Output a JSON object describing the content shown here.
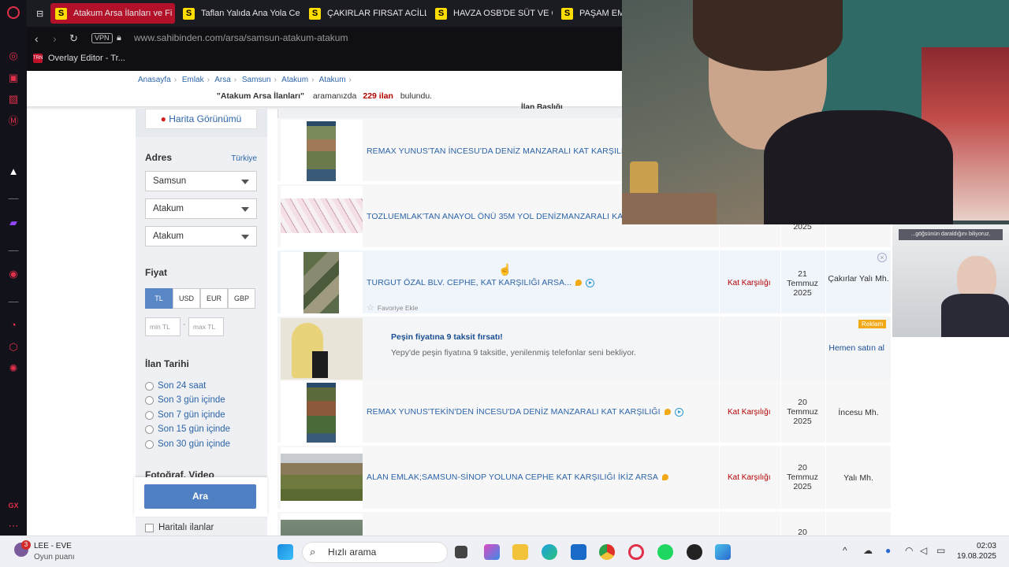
{
  "browser": {
    "tabs": [
      {
        "label": "Atakum Arsa İlanları ve Fi",
        "favicon": "S",
        "active": true
      },
      {
        "label": "Taflan Yalıda Ana Yola Ce",
        "favicon": "S",
        "active": false
      },
      {
        "label": "ÇAKIRLAR FIRSAT ACİLL",
        "favicon": "S",
        "active": false
      },
      {
        "label": "HAVZA OSB'DE SÜT VE G",
        "favicon": "S",
        "active": false
      },
      {
        "label": "PAŞAM EMI",
        "favicon": "S",
        "active": false
      }
    ],
    "vpn_label": "VPN",
    "url": "www.sahibinden.com/arsa/samsun-atakum-atakum",
    "bookmark": {
      "label": "Overlay Editor - Tr...",
      "icon_text": "TRN"
    }
  },
  "page": {
    "breadcrumb": [
      "Anasayfa",
      "Emlak",
      "Arsa",
      "Samsun",
      "Atakum",
      "Atakum"
    ],
    "result": {
      "query": "\"Atakum Arsa İlanları\"",
      "middle": "aramanızda",
      "count": "229 ilan",
      "suffix": "bulundu."
    },
    "table_header": "İlan Başlığı"
  },
  "filter": {
    "map_button": "Harita Görünümü",
    "address_title": "Adres",
    "address_country_link": "Türkiye",
    "address_selects": [
      "Samsun",
      "Atakum",
      "Atakum"
    ],
    "price_title": "Fiyat",
    "currencies": [
      "TL",
      "USD",
      "EUR",
      "GBP"
    ],
    "min_placeholder": "min TL",
    "max_placeholder": "max TL",
    "range_dash": "-",
    "date_title": "İlan Tarihi",
    "date_options": [
      "Son 24 saat",
      "Son 3 gün içinde",
      "Son 7 gün içinde",
      "Son 15 gün içinde",
      "Son 30 gün içinde"
    ],
    "media_title": "Fotoğraf, Video",
    "search_button": "Ara",
    "map_checkbox_label": "Haritalı ilanlar"
  },
  "listings": [
    {
      "title": "REMAX YUNUS'TAN İNCESU'DA DENİZ MANZARALI KAT KARŞILIĞI AR",
      "price": "",
      "date": [
        "",
        "",
        ""
      ],
      "location": ""
    },
    {
      "title": "TOZLUEMLAK'TAN ANAYOL ÖNÜ 35M YOL DENİZMANZARALI KAT KA",
      "price": "",
      "date": [
        "",
        "",
        "2025"
      ],
      "location": ""
    },
    {
      "title": "TURGUT ÖZAL BLV. CEPHE, KAT KARŞILIĞI ARSA...",
      "price": "Kat Karşılığı",
      "date": [
        "21",
        "Temmuz",
        "2025"
      ],
      "location": "Çakırlar Yalı Mh.",
      "favorite": "Favoriye Ekle"
    },
    {
      "title": "REMAX YUNUS'TEKİN'DEN İNCESU'DA DENİZ MANZARALI KAT KARŞILIĞI",
      "price": "Kat Karşılığı",
      "date": [
        "20",
        "Temmuz",
        "2025"
      ],
      "location": "İncesu Mh."
    },
    {
      "title": "ALAN EMLAK;SAMSUN-SİNOP YOLUNA CEPHE KAT KARŞILIĞI İKİZ ARSA",
      "price": "Kat Karşılığı",
      "date": [
        "20",
        "Temmuz",
        "2025"
      ],
      "location": "Yalı Mh."
    },
    {
      "title": "",
      "price": "",
      "date": [
        "20",
        "",
        ""
      ],
      "location": ""
    }
  ],
  "ad": {
    "badge": "Reklam",
    "title": "Peşin fiyatına 9 taksit fırsatı!",
    "text": "Yepy'de peşin fiyatına 9 taksitle, yenilenmiş telefonlar seni bekliyor.",
    "cta": "Hemen satın al"
  },
  "overlay": {
    "caption": "...göğsünün daraldığını biliyoruz."
  },
  "taskbar": {
    "media_title": "LEE - EVE",
    "media_subtitle": "Oyun puanı",
    "media_badge": "3",
    "search_placeholder": "Hızlı arama",
    "time": "02:03",
    "date": "19.08.2025"
  },
  "colors": {
    "accent": "#b3102a",
    "link": "#2c64a8",
    "price": "#b40000",
    "button": "#4f80c3"
  }
}
